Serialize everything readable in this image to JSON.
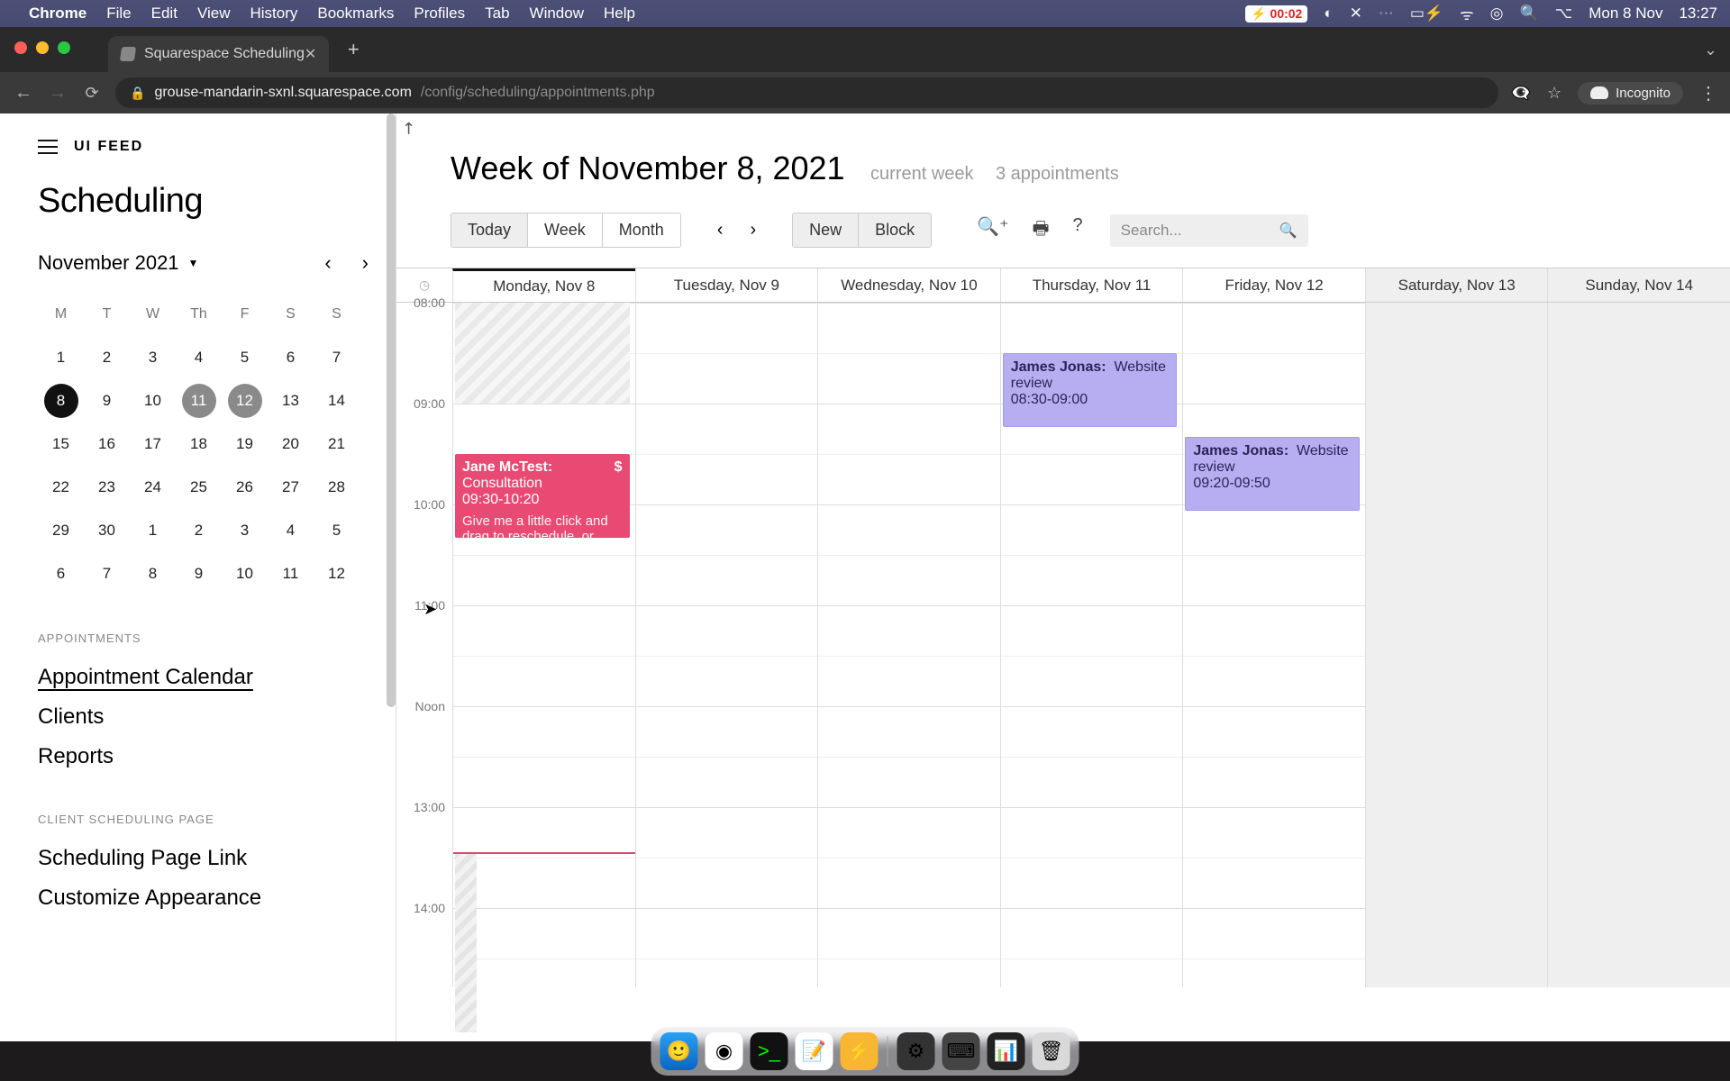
{
  "menubar": {
    "app": "Chrome",
    "items": [
      "File",
      "Edit",
      "View",
      "History",
      "Bookmarks",
      "Profiles",
      "Tab",
      "Window",
      "Help"
    ],
    "battery_timer": "00:02",
    "date": "Mon 8 Nov",
    "time": "13:27"
  },
  "browser": {
    "tab_title": "Squarespace Scheduling",
    "url_host": "grouse-mandarin-sxnl.squarespace.com",
    "url_path": "/config/scheduling/appointments.php",
    "profile_label": "Incognito"
  },
  "sidebar": {
    "brand": "UI FEED",
    "title": "Scheduling",
    "month_label": "November 2021",
    "dow": [
      "M",
      "T",
      "W",
      "Th",
      "F",
      "S",
      "S"
    ],
    "weeks": [
      [
        "1",
        "2",
        "3",
        "4",
        "5",
        "6",
        "7"
      ],
      [
        "8",
        "9",
        "10",
        "11",
        "12",
        "13",
        "14"
      ],
      [
        "15",
        "16",
        "17",
        "18",
        "19",
        "20",
        "21"
      ],
      [
        "22",
        "23",
        "24",
        "25",
        "26",
        "27",
        "28"
      ],
      [
        "29",
        "30",
        "1",
        "2",
        "3",
        "4",
        "5"
      ],
      [
        "6",
        "7",
        "8",
        "9",
        "10",
        "11",
        "12"
      ]
    ],
    "selected_day": "8",
    "busy_days": [
      "11",
      "12"
    ],
    "sections": {
      "appointments_h": "APPOINTMENTS",
      "appointments": [
        "Appointment Calendar",
        "Clients",
        "Reports"
      ],
      "client_h": "CLIENT SCHEDULING PAGE",
      "client": [
        "Scheduling Page Link",
        "Customize Appearance"
      ]
    }
  },
  "main": {
    "title": "Week of November 8, 2021",
    "sub1": "current week",
    "sub2": "3 appointments",
    "view_buttons": {
      "today": "Today",
      "week": "Week",
      "month": "Month"
    },
    "action_buttons": {
      "new": "New",
      "block": "Block"
    },
    "search_placeholder": "Search...",
    "day_headers": [
      "Monday, Nov 8",
      "Tuesday, Nov 9",
      "Wednesday, Nov 10",
      "Thursday, Nov 11",
      "Friday, Nov 12",
      "Saturday, Nov 13",
      "Sunday, Nov 14"
    ],
    "time_labels": [
      "08:00",
      "09:00",
      "10:00",
      "11:00",
      "Noon",
      "13:00",
      "14:00"
    ],
    "appointments": [
      {
        "day": 0,
        "who": "Jane McTest:",
        "what": "Consultation",
        "time": "09:30-10:20",
        "note": "Give me a little click and drag to reschedule, or click to view",
        "money": "$",
        "color": "pink",
        "top_min": 90,
        "dur_min": 50
      },
      {
        "day": 3,
        "who": "James Jonas:",
        "what": "Website review",
        "time": "08:30-09:00",
        "note": "",
        "money": "",
        "color": "purple",
        "top_min": 30,
        "dur_min": 30
      },
      {
        "day": 4,
        "who": "James Jonas:",
        "what": "Website review",
        "time": "09:20-09:50",
        "note": "",
        "money": "",
        "color": "purple",
        "top_min": 80,
        "dur_min": 30
      }
    ],
    "now_minutes_from_8": 327
  },
  "dock": {
    "apps": [
      "finder",
      "chrome",
      "terminal",
      "notes",
      "bolt"
    ],
    "recent": [
      "config",
      "keyboard",
      "activity",
      "trash"
    ]
  }
}
